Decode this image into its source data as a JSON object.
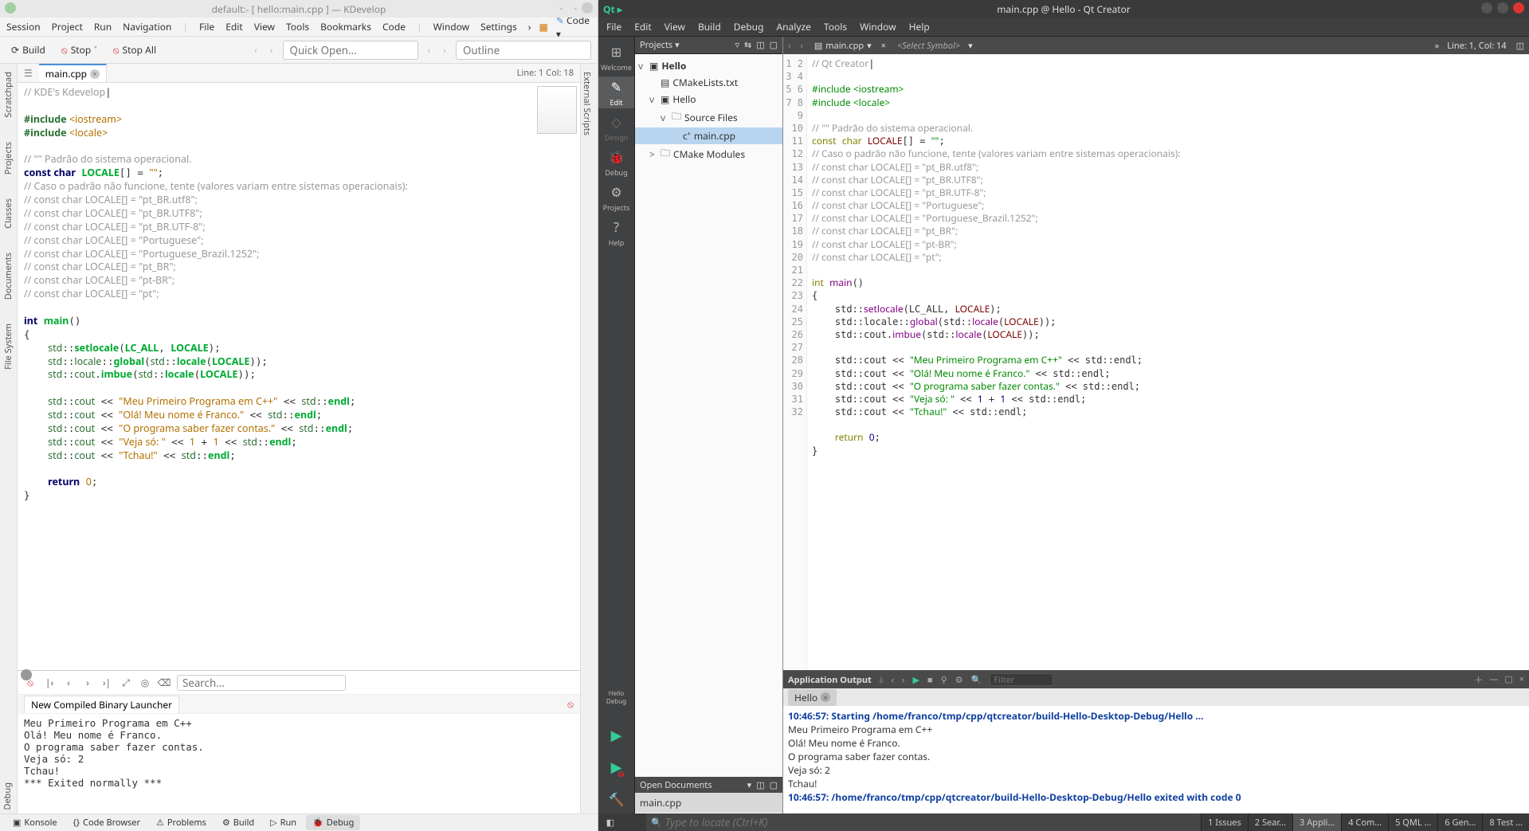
{
  "kdev": {
    "title": "default:- [ hello:main.cpp ] — KDevelop",
    "menu": [
      "Session",
      "Project",
      "Run",
      "Navigation",
      "|",
      "File",
      "Edit",
      "View",
      "Tools",
      "Bookmarks",
      "Code",
      "|",
      "Window",
      "Settings"
    ],
    "menu_right_chevron": "›",
    "menu_right_code": "Code",
    "toolbar": {
      "build": "Build",
      "stop": "Stop",
      "stop_all": "Stop All",
      "quick_open_ph": "Quick Open...",
      "outline_ph": "Outline"
    },
    "leftrail": [
      "Scratchpad",
      "Projects",
      "Classes",
      "Documents",
      "File System"
    ],
    "rightrail": [
      "External Scripts"
    ],
    "tab": {
      "name": "main.cpp",
      "pos": "Line: 1 Col: 18"
    },
    "code_html": "<span class=\"c-comment\">// KDE's Kdevelop</span>|\n\n<span class=\"c-pp\">#include </span><span class=\"c-str\">&lt;iostream&gt;</span>\n<span class=\"c-pp\">#include </span><span class=\"c-str\">&lt;locale&gt;</span>\n\n<span class=\"c-comment\">// \"\" Padrão do sistema operacional.</span>\n<span class=\"c-kw\">const char</span> <span class=\"c-id\">LOCALE</span>[] = <span class=\"c-str\">\"\"</span>;\n<span class=\"c-comment\">// Caso o padrão não funcione, tente (valores variam entre sistemas operacionais):</span>\n<span class=\"c-comment\">// const char LOCALE[] = \"pt_BR.utf8\";</span>\n<span class=\"c-comment\">// const char LOCALE[] = \"pt_BR.UTF8\";</span>\n<span class=\"c-comment\">// const char LOCALE[] = \"pt_BR.UTF-8\";</span>\n<span class=\"c-comment\">// const char LOCALE[] = \"Portuguese\";</span>\n<span class=\"c-comment\">// const char LOCALE[] = \"Portuguese_Brazil.1252\";</span>\n<span class=\"c-comment\">// const char LOCALE[] = \"pt_BR\";</span>\n<span class=\"c-comment\">// const char LOCALE[] = \"pt-BR\";</span>\n<span class=\"c-comment\">// const char LOCALE[] = \"pt\";</span>\n\n<span class=\"c-kw\">int</span> <span class=\"c-id\">main</span>()\n{\n    <span class=\"c-ns\">std</span>::<span class=\"c-id\">setlocale</span>(<span class=\"c-id\">LC_ALL</span>, <span class=\"c-id\">LOCALE</span>);\n    <span class=\"c-ns\">std</span>::<span class=\"c-ns\">locale</span>::<span class=\"c-id\">global</span>(<span class=\"c-ns\">std</span>::<span class=\"c-id\">locale</span>(<span class=\"c-id\">LOCALE</span>));\n    <span class=\"c-ns\">std</span>::<span class=\"c-ns\">cout</span>.<span class=\"c-id\">imbue</span>(<span class=\"c-ns\">std</span>::<span class=\"c-id\">locale</span>(<span class=\"c-id\">LOCALE</span>));\n\n    <span class=\"c-ns\">std</span>::<span class=\"c-ns\">cout</span> &lt;&lt; <span class=\"c-str\">\"Meu Primeiro Programa em C++\"</span> &lt;&lt; <span class=\"c-ns\">std</span>::<span class=\"c-id\">endl</span>;\n    <span class=\"c-ns\">std</span>::<span class=\"c-ns\">cout</span> &lt;&lt; <span class=\"c-str\">\"Olá! Meu nome é Franco.\"</span> &lt;&lt; <span class=\"c-ns\">std</span>::<span class=\"c-id\">endl</span>;\n    <span class=\"c-ns\">std</span>::<span class=\"c-ns\">cout</span> &lt;&lt; <span class=\"c-str\">\"O programa saber fazer contas.\"</span> &lt;&lt; <span class=\"c-ns\">std</span>::<span class=\"c-id\">endl</span>;\n    <span class=\"c-ns\">std</span>::<span class=\"c-ns\">cout</span> &lt;&lt; <span class=\"c-str\">\"Veja só: \"</span> &lt;&lt; <span class=\"c-num\">1</span> + <span class=\"c-num\">1</span> &lt;&lt; <span class=\"c-ns\">std</span>::<span class=\"c-id\">endl</span>;\n    <span class=\"c-ns\">std</span>::<span class=\"c-ns\">cout</span> &lt;&lt; <span class=\"c-str\">\"Tchau!\"</span> &lt;&lt; <span class=\"c-ns\">std</span>::<span class=\"c-id\">endl</span>;\n\n    <span class=\"c-kw\">return</span> <span class=\"c-num\">0</span>;\n}",
    "output": {
      "search_ph": "Search...",
      "tab": "New Compiled Binary Launcher",
      "text": "Meu Primeiro Programa em C++\nOlá! Meu nome é Franco.\nO programa saber fazer contas.\nVeja só: 2\nTchau!\n*** Exited normally ***"
    },
    "debug_label": "Debug",
    "bottombar": [
      {
        "icon": "▣",
        "label": "Konsole"
      },
      {
        "icon": "{}",
        "label": "Code Browser"
      },
      {
        "icon": "⚠",
        "label": "Problems"
      },
      {
        "icon": "⚙",
        "label": "Build"
      },
      {
        "icon": "▷",
        "label": "Run"
      },
      {
        "icon": "🐞",
        "label": "Debug"
      }
    ],
    "bottombar_active": 5
  },
  "qtc": {
    "title": "main.cpp @ Hello - Qt Creator",
    "menu": [
      "File",
      "Edit",
      "View",
      "Build",
      "Debug",
      "Analyze",
      "Tools",
      "Window",
      "Help"
    ],
    "modes": [
      {
        "icon": "⊞",
        "label": "Welcome"
      },
      {
        "icon": "✎",
        "label": "Edit",
        "active": true
      },
      {
        "icon": "◇",
        "label": "Design",
        "disabled": true
      },
      {
        "icon": "🐞",
        "label": "Debug"
      },
      {
        "icon": "⚙",
        "label": "Projects"
      },
      {
        "icon": "?",
        "label": "Help"
      }
    ],
    "run_target": "Hello\nDebug",
    "projects_label": "Projects",
    "tree": [
      {
        "exp": "v",
        "depth": 0,
        "icon": "▣",
        "label": "Hello",
        "bold": true
      },
      {
        "exp": "",
        "depth": 1,
        "icon": "▤",
        "label": "CMakeLists.txt"
      },
      {
        "exp": "v",
        "depth": 1,
        "icon": "▣",
        "label": "Hello"
      },
      {
        "exp": "v",
        "depth": 2,
        "icon": "🗀",
        "label": "Source Files"
      },
      {
        "exp": "",
        "depth": 3,
        "icon": "c⁺",
        "label": "main.cpp",
        "sel": true
      },
      {
        "exp": ">",
        "depth": 1,
        "icon": "🗀",
        "label": "CMake Modules"
      }
    ],
    "opendocs_label": "Open Documents",
    "opendocs": [
      "main.cpp"
    ],
    "editortab": {
      "file": "main.cpp",
      "symbol_ph": "<Select Symbol>",
      "pos": "Line: 1, Col: 14"
    },
    "gutter_lines": 32,
    "code_html": "<span class=\"q-comment\">// Qt Creator</span>|\n\n<span class=\"q-pp\">#include &lt;iostream&gt;</span>\n<span class=\"q-pp\">#include &lt;locale&gt;</span>\n\n<span class=\"q-comment\">// \"\" Padrão do sistema operacional.</span>\n<span class=\"q-kw\">const</span> <span class=\"q-kw\">char</span> <span class=\"q-id\">LOCALE</span>[] = <span class=\"q-str\">\"\"</span>;\n<span class=\"q-comment\">// Caso o padrão não funcione, tente (valores variam entre sistemas operacionais):</span>\n<span class=\"q-comment\">// const char LOCALE[] = \"pt_BR.utf8\";</span>\n<span class=\"q-comment\">// const char LOCALE[] = \"pt_BR.UTF8\";</span>\n<span class=\"q-comment\">// const char LOCALE[] = \"pt_BR.UTF-8\";</span>\n<span class=\"q-comment\">// const char LOCALE[] = \"Portuguese\";</span>\n<span class=\"q-comment\">// const char LOCALE[] = \"Portuguese_Brazil.1252\";</span>\n<span class=\"q-comment\">// const char LOCALE[] = \"pt_BR\";</span>\n<span class=\"q-comment\">// const char LOCALE[] = \"pt-BR\";</span>\n<span class=\"q-comment\">// const char LOCALE[] = \"pt\";</span>\n\n<span class=\"q-kw\">int</span> <span class=\"q-type\">main</span>()\n{\n    std::<span class=\"q-type\">setlocale</span>(LC_ALL, <span class=\"q-id\">LOCALE</span>);\n    std::locale::<span class=\"q-type\">global</span>(std::<span class=\"q-type\">locale</span>(<span class=\"q-id\">LOCALE</span>));\n    std::cout.<span class=\"q-type\">imbue</span>(std::<span class=\"q-type\">locale</span>(<span class=\"q-id\">LOCALE</span>));\n\n    std::cout &lt;&lt; <span class=\"q-str\">\"Meu Primeiro Programa em C++\"</span> &lt;&lt; std::endl;\n    std::cout &lt;&lt; <span class=\"q-str\">\"Olá! Meu nome é Franco.\"</span> &lt;&lt; std::endl;\n    std::cout &lt;&lt; <span class=\"q-str\">\"O programa saber fazer contas.\"</span> &lt;&lt; std::endl;\n    std::cout &lt;&lt; <span class=\"q-str\">\"Veja só: \"</span> &lt;&lt; <span class=\"q-num\">1</span> + <span class=\"q-num\">1</span> &lt;&lt; std::endl;\n    std::cout &lt;&lt; <span class=\"q-str\">\"Tchau!\"</span> &lt;&lt; std::endl;\n\n    <span class=\"q-kw\">return</span> <span class=\"q-num\">0</span>;\n}\n",
    "output": {
      "title": "Application Output",
      "filter_ph": "Filter",
      "tab": "Hello",
      "lines": [
        {
          "cls": "meta",
          "text": "10:46:57: Starting /home/franco/tmp/cpp/qtcreator/build-Hello-Desktop-Debug/Hello ..."
        },
        {
          "cls": "",
          "text": "Meu Primeiro Programa em C++"
        },
        {
          "cls": "",
          "text": "Olá! Meu nome é Franco."
        },
        {
          "cls": "",
          "text": "O programa saber fazer contas."
        },
        {
          "cls": "",
          "text": "Veja só: 2"
        },
        {
          "cls": "",
          "text": "Tchau!"
        },
        {
          "cls": "meta",
          "text": "10:46:57: /home/franco/tmp/cpp/qtcreator/build-Hello-Desktop-Debug/Hello exited with code 0"
        }
      ]
    },
    "bottombar": {
      "locator_ph": "Type to locate (Ctrl+K)",
      "panes": [
        "1  Issues",
        "2  Sear...",
        "3  Appli...",
        "4  Com...",
        "5  QML ...",
        "6  Gen...",
        "8  Test ..."
      ],
      "active": 2
    }
  }
}
